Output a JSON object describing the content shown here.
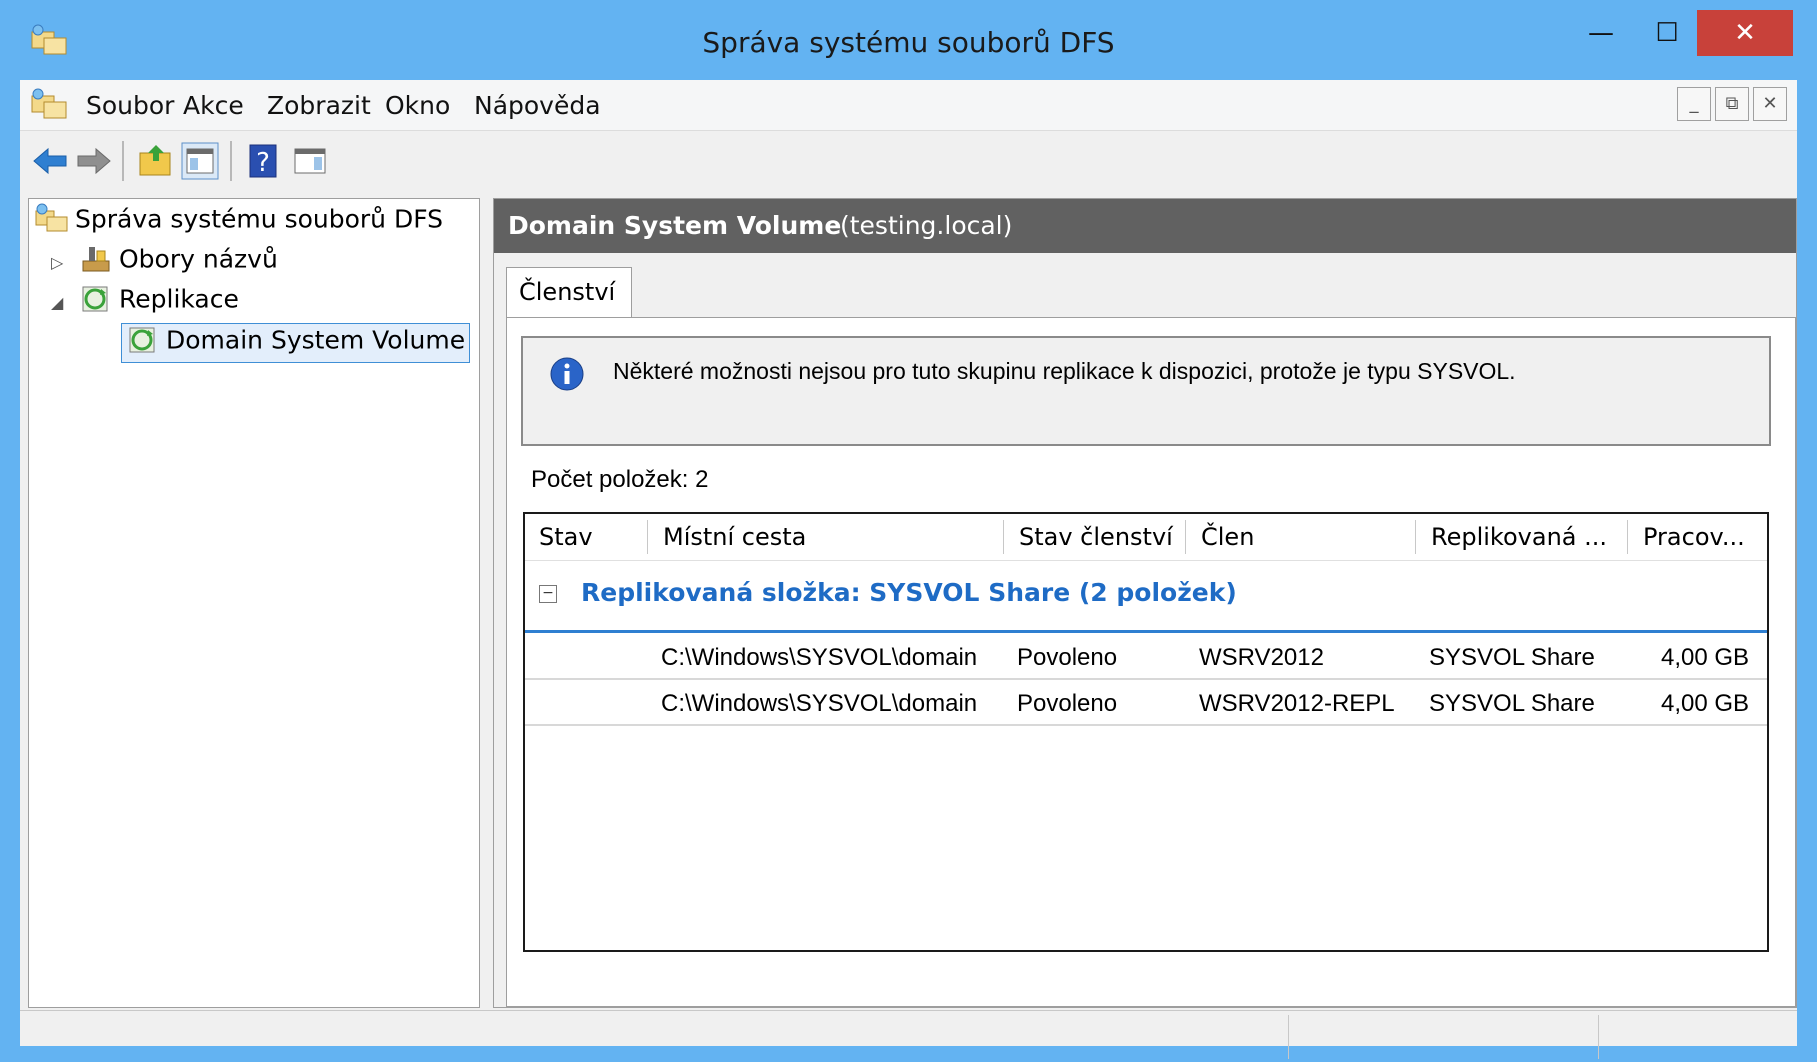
{
  "window": {
    "title": "Správa systému souborů DFS",
    "controls": {
      "minimize": "—",
      "maximize": "☐",
      "close": "✕"
    }
  },
  "menubar": {
    "items": [
      "Soubor",
      "Akce",
      "Zobrazit",
      "Okno",
      "Nápověda"
    ],
    "mdi": {
      "minimize": "_",
      "restore": "⧉",
      "close": "✕"
    }
  },
  "toolbar": {
    "icons": [
      "back-arrow-icon",
      "forward-arrow-icon",
      "up-folder-icon",
      "show-hide-tree-icon",
      "help-icon",
      "action-pane-icon"
    ]
  },
  "tree": {
    "root": "Správa systému souborů DFS",
    "items": [
      {
        "label": "Obory názvů",
        "expander": "▷"
      },
      {
        "label": "Replikace",
        "expander": "◢"
      }
    ],
    "selected": "Domain System Volume"
  },
  "details": {
    "title": "Domain System Volume",
    "subtitle": "(testing.local)",
    "tab": "Členství",
    "info": "Některé možnosti nejsou pro tuto skupinu replikace k dispozici, protože je typu SYSVOL.",
    "count": "Počet položek: 2",
    "columns": [
      "Stav",
      "Místní cesta",
      "Stav členství",
      "Člen",
      "Replikovaná ...",
      "Pracov..."
    ],
    "group": {
      "toggle": "−",
      "label": "Replikovaná složka: SYSVOL Share (2 položek)"
    },
    "rows": [
      {
        "stav": "",
        "path": "C:\\Windows\\SYSVOL\\domain",
        "membership": "Povoleno",
        "member": "WSRV2012",
        "folder": "SYSVOL Share",
        "staging": "4,00 GB"
      },
      {
        "stav": "",
        "path": "C:\\Windows\\SYSVOL\\domain",
        "membership": "Povoleno",
        "member": "WSRV2012-REPL",
        "folder": "SYSVOL Share",
        "staging": "4,00 GB"
      }
    ]
  },
  "colors": {
    "titlebar": "#63b3f2",
    "close": "#c8413a",
    "header": "#616161",
    "group": "#1e6bc5"
  }
}
